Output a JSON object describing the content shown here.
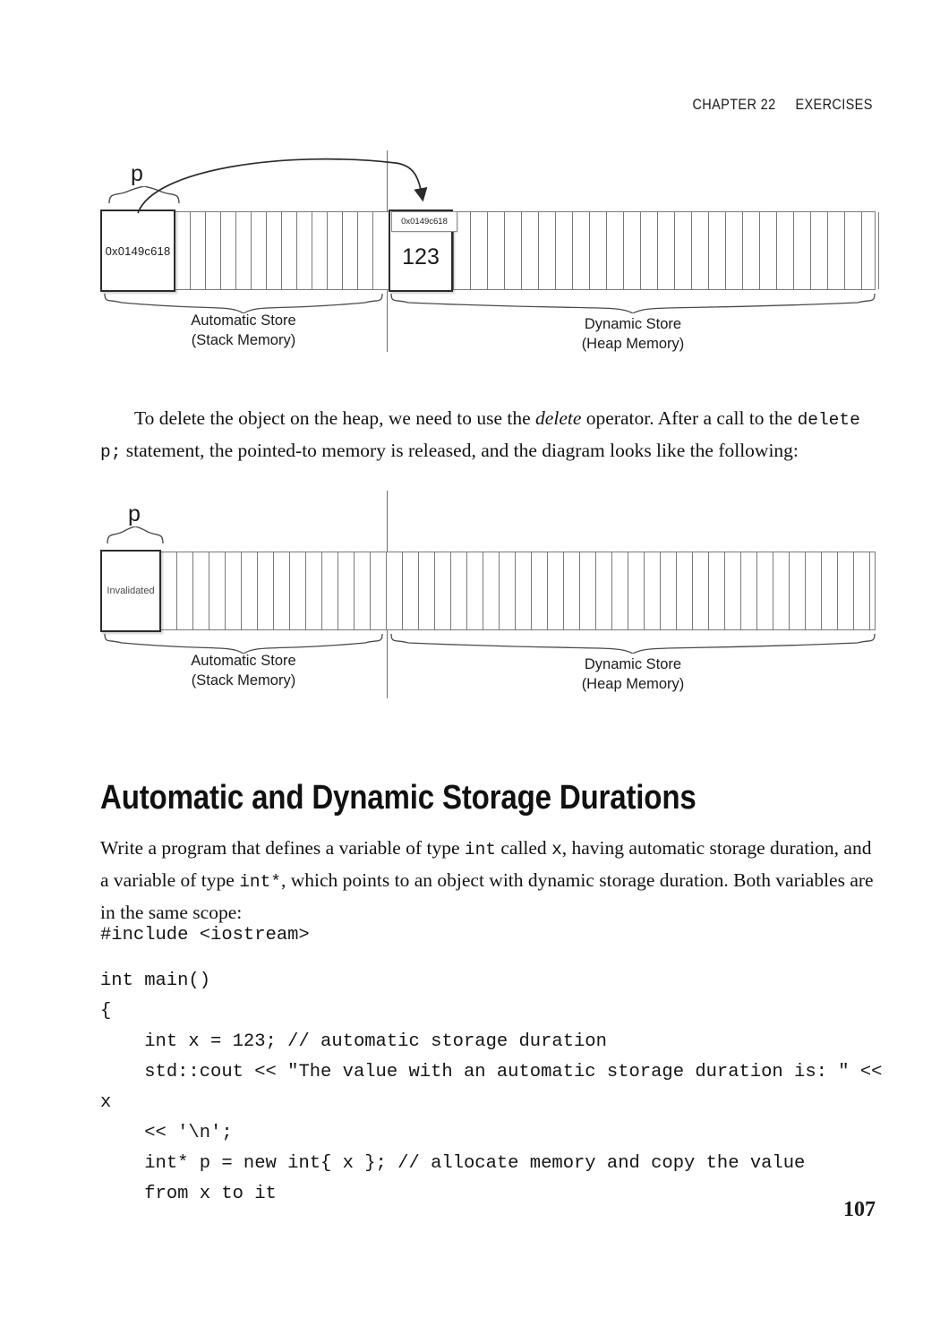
{
  "running_head": "CHAPTER 22     EXERCISES",
  "folio": "107",
  "diagram_1": {
    "pointer_label": "p",
    "stack_cell_value": "0x0149c618",
    "heap_cell_value": "123",
    "heap_cell_address_tag": "0x0149c618",
    "stack_region_line1": "Automatic Store",
    "stack_region_line2": "(Stack Memory)",
    "heap_region_line1": "Dynamic Store",
    "heap_region_line2": "(Heap Memory)",
    "stack_cell_count": 14,
    "heap_cell_count": 25
  },
  "diagram_2": {
    "pointer_label": "p",
    "stack_cell_value": "Invalidated",
    "stack_region_line1": "Automatic Store",
    "stack_region_line2": "(Stack Memory)",
    "heap_region_line1": "Dynamic Store",
    "heap_region_line2": "(Heap Memory)",
    "stack_cell_count": 16,
    "heap_cell_count": 28
  },
  "paragraph_1": {
    "part_1": "To delete the object on the heap, we need to use the ",
    "emphasis": "delete",
    "part_2": " operator. After a call to the ",
    "code": "delete p;",
    "part_3": " statement, the pointed-to memory is released, and the diagram looks like the following:"
  },
  "heading": "Automatic and Dynamic Storage Durations",
  "paragraph_2": {
    "part_1": "Write a program that defines a variable of type ",
    "code_1": "int",
    "part_2": " called ",
    "code_2": "x",
    "part_3": ", having automatic storage duration, and a variable of type ",
    "code_3": "int*",
    "part_4": ", which points to an object with dynamic storage duration. Both variables are in the same scope:"
  },
  "code_block": {
    "line_1": "#include <iostream>",
    "line_2": "int main()",
    "line_3": "{",
    "line_4": "    int x = 123; // automatic storage duration",
    "line_5": "    std::cout << \"The value with an automatic storage duration is: \" << x",
    "line_6": "    << '\\n';",
    "line_7": "    int* p = new int{ x }; // allocate memory and copy the value",
    "line_8": "    from x to it"
  }
}
